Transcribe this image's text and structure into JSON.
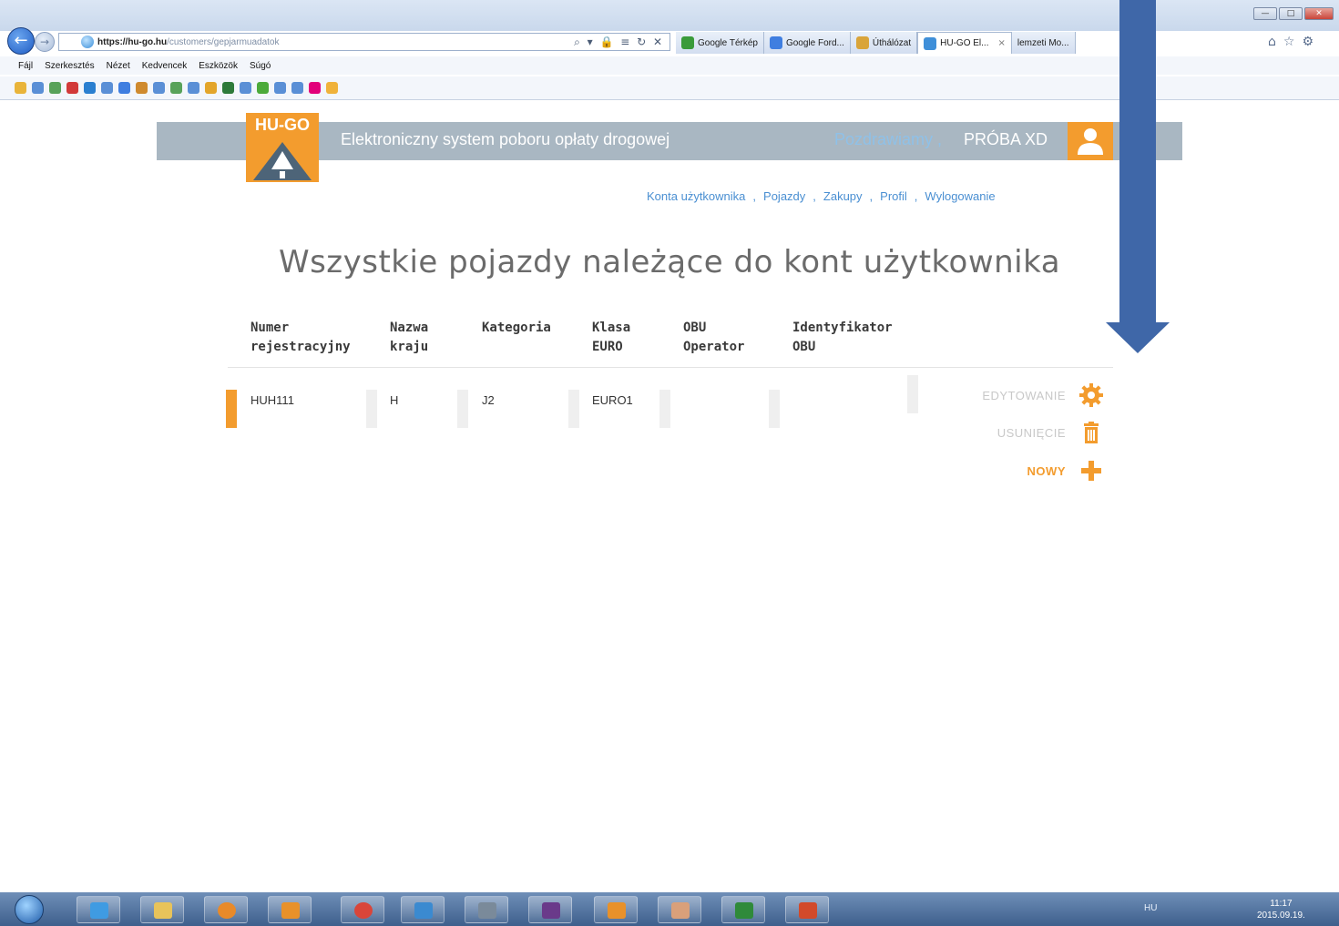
{
  "browser": {
    "url_host": "https://hu-go.hu",
    "url_path": "/customers/gepjarmuadatok",
    "address_tools": "⌕ ▾ 🔒 ≡ ↻ ✕",
    "tabs": [
      {
        "label": "Google Térkép",
        "color": "#3a9b3a"
      },
      {
        "label": "Google Ford...",
        "color": "#3f7ee0"
      },
      {
        "label": "Úthálózat",
        "color": "#d9a43a"
      },
      {
        "label": "HU-GO El...",
        "color": "#3f8fd9",
        "active": true
      },
      {
        "label": "lemzeti Mo...",
        "color": "#3a7acb"
      }
    ],
    "menu": [
      "Fájl",
      "Szerkesztés",
      "Nézet",
      "Kedvencek",
      "Eszközök",
      "Súgó"
    ],
    "window_controls": [
      "—",
      "□",
      "✕"
    ]
  },
  "header": {
    "logo_text": "HU-GO",
    "tagline": "Elektroniczny system poboru opłaty drogowej",
    "greeting": "Pozdrawiamy ,",
    "username": "PRÓBA XD"
  },
  "topnav": [
    "Konta użytkownika",
    "Pojazdy",
    "Zakupy",
    "Profil",
    "Wylogowanie"
  ],
  "topnav_separator": ",",
  "page_title": "Wszystkie pojazdy należące do kont użytkownika",
  "table": {
    "headers": [
      [
        "Numer",
        "rejestracyjny"
      ],
      [
        "Nazwa",
        "kraju"
      ],
      [
        "Kategoria",
        ""
      ],
      [
        "Klasa",
        "EURO"
      ],
      [
        "OBU",
        "Operator"
      ],
      [
        "Identyfikator",
        "OBU"
      ]
    ],
    "row": [
      "HUH111",
      "H",
      "J2",
      "EURO1",
      "",
      ""
    ]
  },
  "actions": {
    "edit": "EDYTOWANIE",
    "delete": "USUNIĘCIE",
    "new": "NOWY"
  },
  "colors": {
    "accent": "#f39c2e",
    "header_band": "#a9b7c2",
    "link": "#4a8fd2",
    "annotation_arrow": "#3f67a8"
  },
  "taskbar": {
    "language": "HU",
    "time": "11:17",
    "date": "2015.09.19."
  }
}
